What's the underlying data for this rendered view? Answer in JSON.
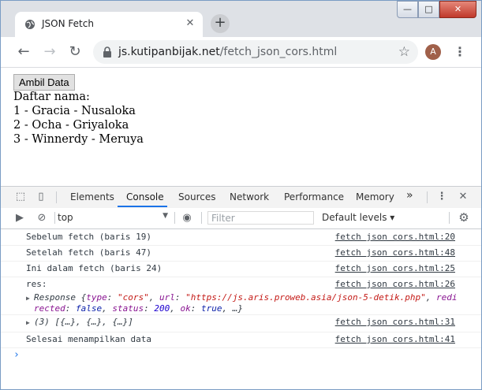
{
  "browser": {
    "tab_title": "JSON Fetch",
    "tab_close": "✕",
    "new_tab": "+",
    "url_host": "js.kutipanbijak.net",
    "url_path": "/fetch_json_cors.html",
    "profile_initial": "A",
    "window_controls": {
      "minimize": "—",
      "maximize": "□",
      "close": "✕"
    }
  },
  "page": {
    "button_label": "Ambil Data",
    "heading": "Daftar nama:",
    "lines": [
      "1 - Gracia - Nusaloka",
      "2 - Ocha - Griyaloka",
      "3 - Winnerdy - Meruya"
    ]
  },
  "devtools": {
    "tabs": [
      "Elements",
      "Console",
      "Sources",
      "Network",
      "Performance",
      "Memory"
    ],
    "active_tab": "Console",
    "more_tabs": "»",
    "context": "top",
    "filter_placeholder": "Filter",
    "levels": "Default levels ▾",
    "logs": [
      {
        "msg": "Sebelum fetch (baris 19)",
        "src": "fetch json cors.html:20"
      },
      {
        "msg": "Setelah fetch (baris 47)",
        "src": "fetch json cors.html:48"
      },
      {
        "msg": "Ini dalam fetch (baris 24)",
        "src": "fetch json cors.html:25"
      },
      {
        "msg": "res:",
        "src": "fetch json cors.html:26"
      },
      {
        "msg": "(3) [{…}, {…}, {…}]",
        "src": "fetch json cors.html:31"
      },
      {
        "msg": "Selesai menampilkan data",
        "src": "fetch json cors.html:41"
      }
    ],
    "response_obj": {
      "prefix": "Response {",
      "type_key": "type",
      "type_val": "\"cors\"",
      "url_key": "url",
      "url_val": "\"https://js.aris.proweb.asia/json-5-detik.php\"",
      "redirected_tail": "redi",
      "line2_key": "rected",
      "redirected_val": "false",
      "status_key": "status",
      "status_val": "200",
      "ok_key": "ok",
      "ok_val": "true",
      "suffix": ", …}"
    },
    "prompt": "›"
  },
  "colors": {
    "accent": "#1a73e8",
    "string": "#c41a16",
    "keyword": "#0d22aa"
  }
}
